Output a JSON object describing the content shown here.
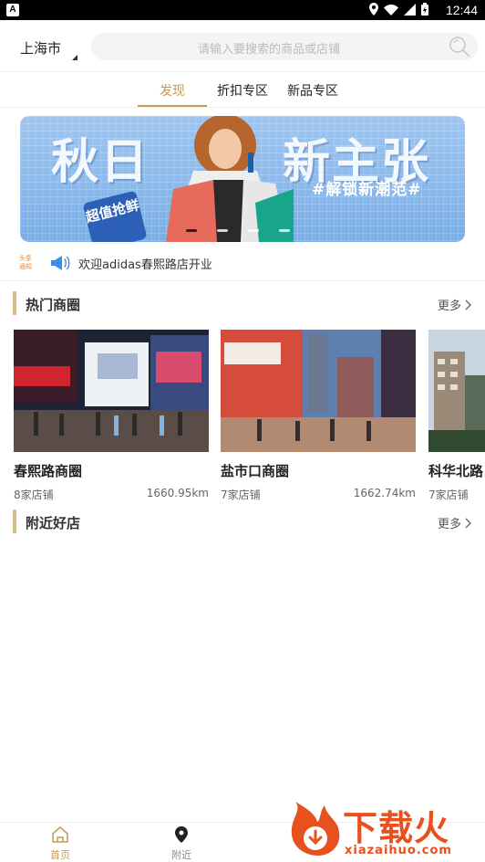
{
  "status_bar": {
    "time": "12:44",
    "app_badge": "A"
  },
  "header": {
    "city": "上海市",
    "search_placeholder": "请输入要搜索的商品或店铺"
  },
  "tabs": [
    {
      "label": "发现",
      "active": true
    },
    {
      "label": "折扣专区",
      "active": false
    },
    {
      "label": "新品专区",
      "active": false
    }
  ],
  "banner": {
    "left_title": "秋日",
    "right_title": "新主张",
    "subtitle": "#解锁新潮范#",
    "badge": "超值抢鲜",
    "slide_count": 4,
    "active_slide": 1
  },
  "notice": {
    "logo_text": "头条通知",
    "text": "欢迎adidas春熙路店开业"
  },
  "hot_districts": {
    "title": "热门商圈",
    "more": "更多",
    "items": [
      {
        "name": "春熙路商圈",
        "store_count": "8家店铺",
        "distance": "1660.95km"
      },
      {
        "name": "盐市口商圈",
        "store_count": "7家店铺",
        "distance": "1662.74km"
      },
      {
        "name": "科华北路",
        "store_count": "7家店铺",
        "distance": ""
      }
    ]
  },
  "nearby_shops": {
    "title": "附近好店",
    "more": "更多"
  },
  "bottom_nav": [
    {
      "label": "首页",
      "active": true
    },
    {
      "label": "附近",
      "active": false
    }
  ],
  "watermark": {
    "title": "下载火",
    "url": "xiazaihuo.com"
  },
  "colors": {
    "accent": "#c79a54",
    "section_bar": "#d8b98a",
    "watermark": "#e8501e"
  }
}
